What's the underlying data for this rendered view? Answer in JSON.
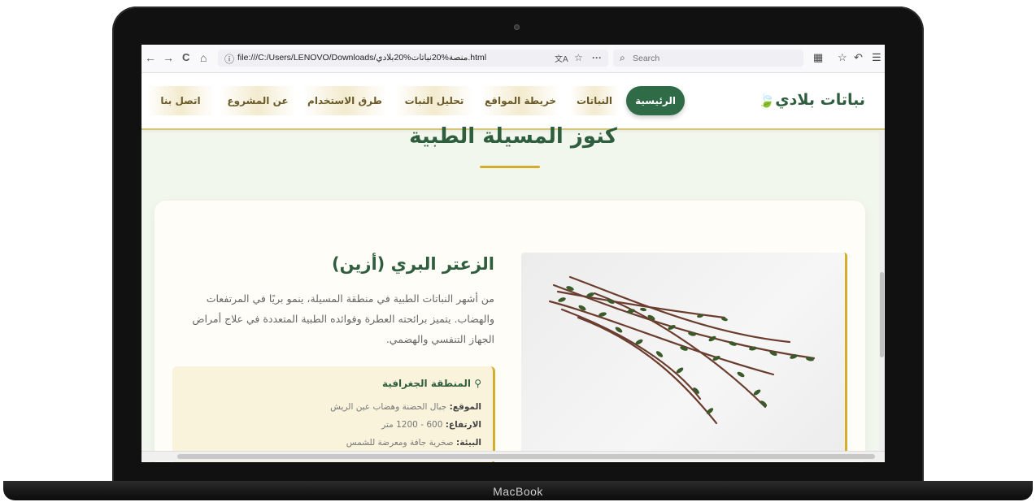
{
  "device": {
    "brand": "MacBook"
  },
  "browser": {
    "url": "file:///C:/Users/LENOVO/Downloads/منصة%20نباتات%20بلادي.html",
    "search_placeholder": "Search",
    "icons": {
      "back": "←",
      "forward": "→",
      "reload": "C",
      "home": "⌂",
      "page_info": "ⓘ",
      "translate": "文A",
      "bookmark": "☆",
      "more": "···",
      "search": "🔍",
      "extensions": "▦",
      "reading_list": "☆",
      "history": "↶",
      "menu": "☰"
    }
  },
  "site": {
    "logo": "نباتات بلادي",
    "logo_icon": "🍃",
    "nav": [
      {
        "label": "الرئيسية",
        "active": true
      },
      {
        "label": "النباتات",
        "active": false
      },
      {
        "label": "خريطة المواقع",
        "active": false
      },
      {
        "label": "تحليل النبات",
        "active": false
      },
      {
        "label": "طرق الاستخدام",
        "active": false
      },
      {
        "label": "عن المشروع",
        "active": false
      },
      {
        "label": "اتصل بنا",
        "active": false
      }
    ],
    "accent_green": "#2f6b46",
    "accent_gold": "#d4ad2f"
  },
  "content": {
    "section_title": "كنوز المسيلة الطبية",
    "plant": {
      "name": "الزعتر البري (أزين)",
      "description": "من أشهر النباتات الطبية في منطقة المسيلة، ينمو بريًا في المرتفعات والهضاب. يتميز برائحته العطرة وفوائده الطبية المتعددة في علاج أمراض الجهاز التنفسي والهضمي.",
      "info": {
        "heading": "المنطقة الجغرافية",
        "location_label": "الموقع:",
        "location_value": "جبال الحضنة وهضاب عين الريش",
        "altitude_label": "الارتفاع:",
        "altitude_value": "600 - 1200 متر",
        "environment_label": "البيئة:",
        "environment_value": "صخرية جافة ومعرضة للشمس"
      }
    }
  }
}
